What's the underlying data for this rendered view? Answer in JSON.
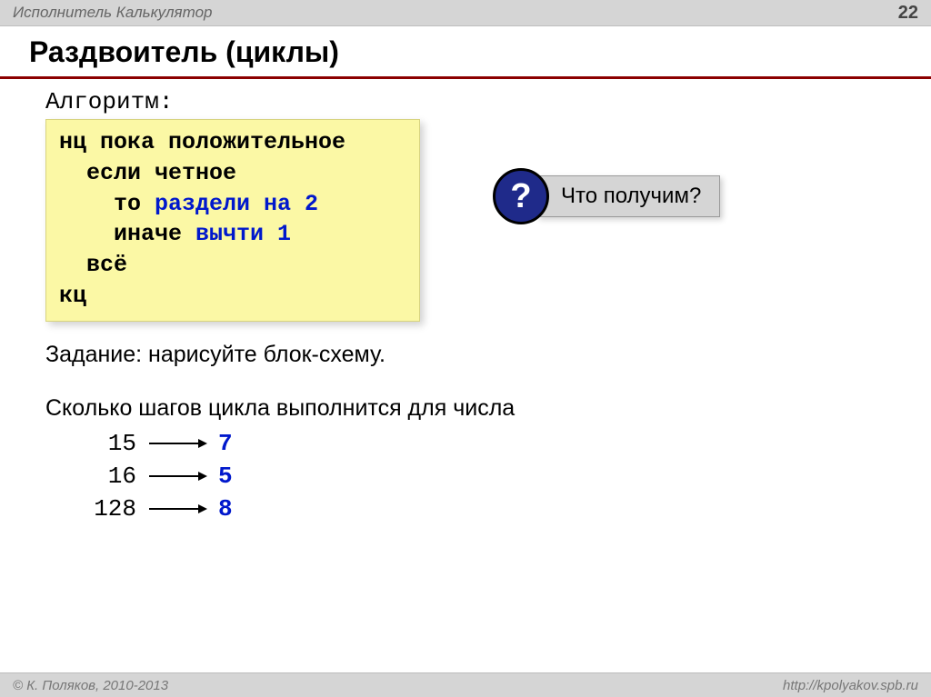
{
  "header": {
    "topic": "Исполнитель Калькулятор",
    "page": "22"
  },
  "title": "Раздвоитель (циклы)",
  "algo_label": "Алгоритм:",
  "code": {
    "l1": "нц пока положительное",
    "l2": "  если четное",
    "l3a": "    то ",
    "l3b": "раздели на 2",
    "l4a": "    иначе ",
    "l4b": "вычти 1",
    "l5": "  всё",
    "l6": "кц"
  },
  "task": "Задание: нарисуйте блок-схему.",
  "question_line": "Сколько шагов цикла выполнится для числа",
  "callout": {
    "mark": "?",
    "text": "Что получим?"
  },
  "steps": [
    {
      "n": "15",
      "a": "7"
    },
    {
      "n": "16",
      "a": "5"
    },
    {
      "n": "128",
      "a": "8"
    }
  ],
  "footer": {
    "left": "© К. Поляков, 2010-2013",
    "right": "http://kpolyakov.spb.ru"
  }
}
